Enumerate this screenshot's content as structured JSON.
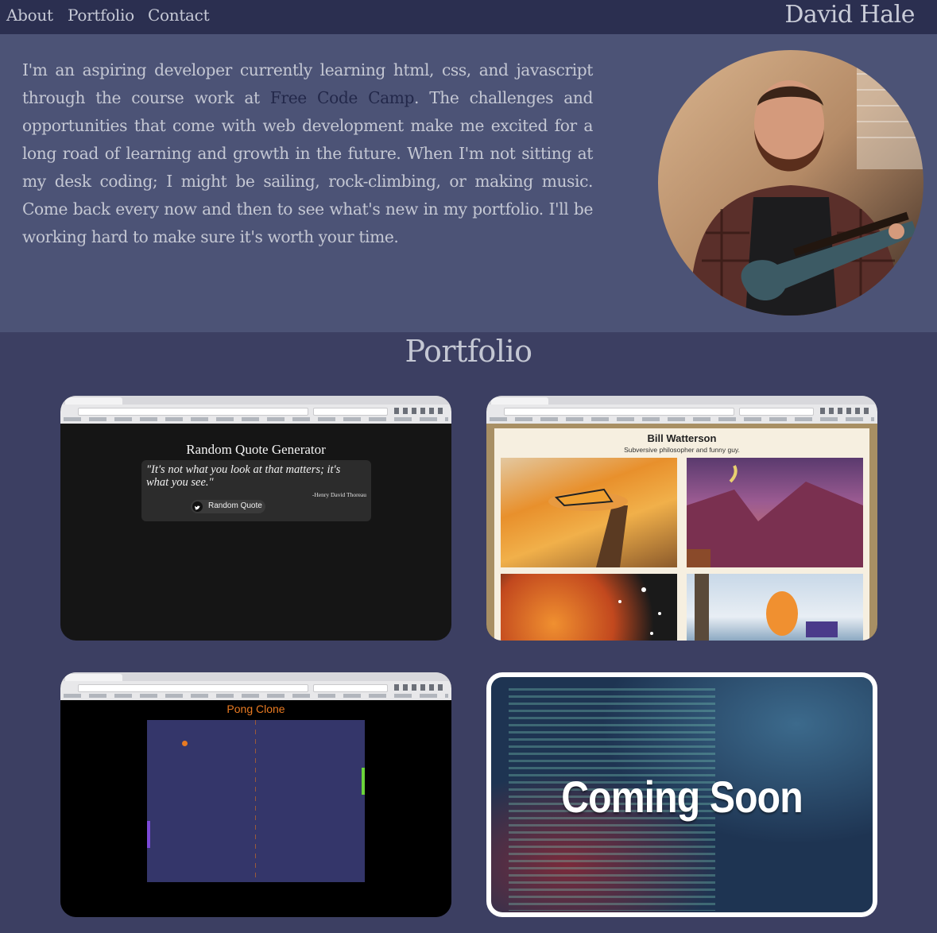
{
  "nav": {
    "items": [
      "About",
      "Portfolio",
      "Contact"
    ],
    "brand": "David Hale"
  },
  "about": {
    "bio_before": "I'm an aspiring developer currently learning html, css, and javascript through the course work at ",
    "link_text": "Free Code Camp",
    "bio_after": ". The challenges and opportunities that come with web development make me excited for a long road of learning and growth in the future. When I'm not sitting at my desk coding; I might be sailing, rock-climbing, or making music. Come back every now and then to see what's new in my portfolio. I'll be working hard to make sure it's worth your time."
  },
  "portfolio": {
    "title": "Portfolio",
    "projects": [
      {
        "title": "Random Quote Generator",
        "quote": "\"It's not what you look at that matters; it's what you see.\"",
        "author": "-Henry David Thoreau",
        "button": "Random Quote"
      },
      {
        "title": "Bill Watterson",
        "subtitle": "Subversive philosopher and funny guy."
      },
      {
        "title": "Pong Clone"
      },
      {
        "title": "Coming Soon"
      }
    ]
  },
  "colors": {
    "nav_bg": "#2b2f50",
    "about_bg": "#4c5376",
    "page_bg": "#3c3f62",
    "link": "#23284a",
    "pong_accent": "#e87a22"
  }
}
